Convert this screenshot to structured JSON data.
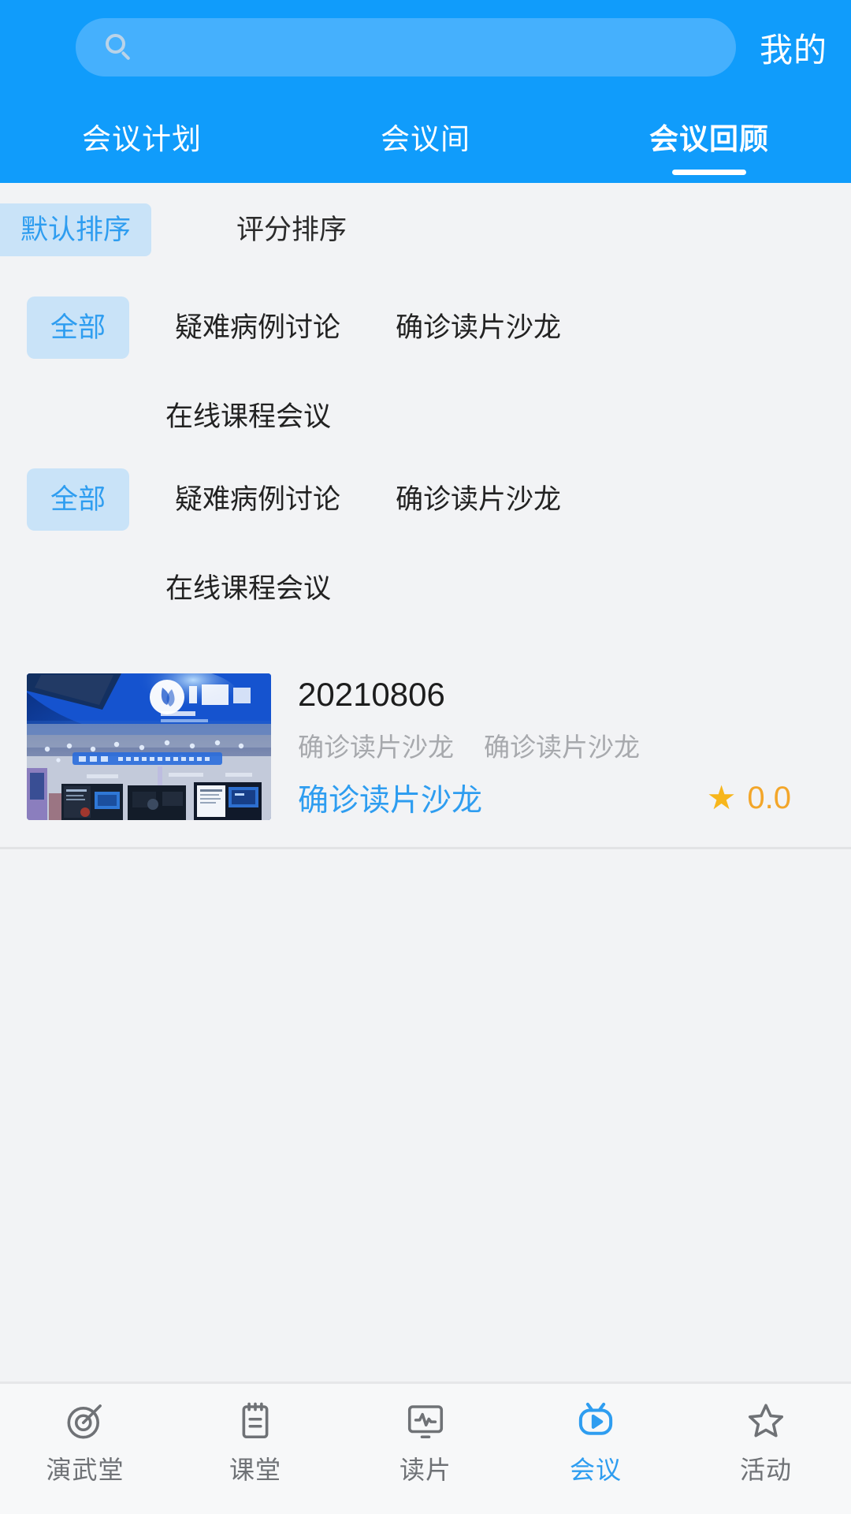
{
  "header": {
    "search": {
      "placeholder": "",
      "value": "",
      "icon": "search-icon"
    },
    "mine_label": "我的",
    "tabs": [
      {
        "label": "会议计划",
        "active": false
      },
      {
        "label": "会议间",
        "active": false
      },
      {
        "label": "会议回顾",
        "active": true
      }
    ]
  },
  "sort": {
    "options": [
      {
        "label": "默认排序",
        "selected": true
      },
      {
        "label": "评分排序",
        "selected": false
      }
    ]
  },
  "filter_groups": [
    {
      "chips": [
        {
          "label": "全部",
          "selected": true
        },
        {
          "label": "疑难病例讨论",
          "selected": false
        },
        {
          "label": "确诊读片沙龙",
          "selected": false
        },
        {
          "label": "在线课程会议",
          "selected": false
        }
      ]
    },
    {
      "chips": [
        {
          "label": "全部",
          "selected": true
        },
        {
          "label": "疑难病例讨论",
          "selected": false
        },
        {
          "label": "确诊读片沙龙",
          "selected": false
        },
        {
          "label": "在线课程会议",
          "selected": false
        }
      ]
    }
  ],
  "cards": [
    {
      "thumbnail_alt": "会议展台照片",
      "title": "20210806",
      "meta": [
        "确诊读片沙龙",
        "确诊读片沙龙"
      ],
      "category": "确诊读片沙龙",
      "rating_icon": "star-icon",
      "rating": "0.0"
    }
  ],
  "bottom_nav": [
    {
      "label": "演武堂",
      "icon": "target-icon",
      "active": false
    },
    {
      "label": "课堂",
      "icon": "notepad-icon",
      "active": false
    },
    {
      "label": "读片",
      "icon": "monitor-waveform-icon",
      "active": false
    },
    {
      "label": "会议",
      "icon": "tv-play-icon",
      "active": true
    },
    {
      "label": "活动",
      "icon": "star-outline-icon",
      "active": false
    }
  ],
  "colors": {
    "brand_blue": "#109cfb",
    "accent_blue": "#2e9df0",
    "chip_bg": "#c9e3f8",
    "rating_orange": "#f3a62a",
    "page_bg": "#f2f3f5"
  }
}
